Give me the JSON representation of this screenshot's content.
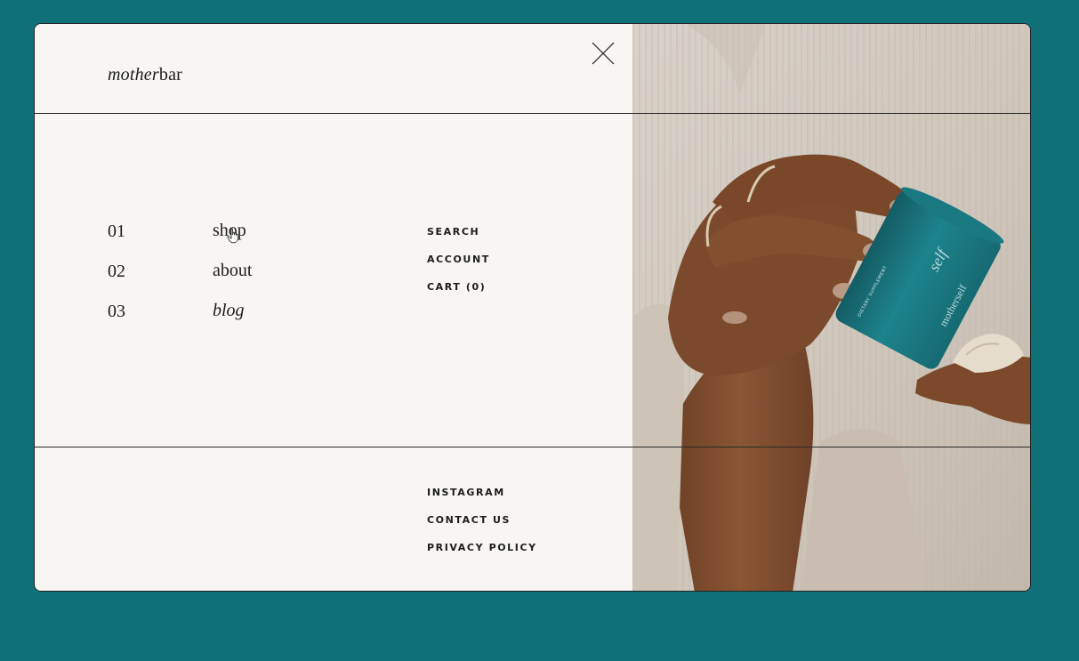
{
  "brand": {
    "logo_italic": "mother",
    "logo_regular": "bar"
  },
  "menu": {
    "primary": [
      {
        "number": "01",
        "label": "shop"
      },
      {
        "number": "02",
        "label": "about"
      },
      {
        "number": "03",
        "label": "blog"
      }
    ],
    "utility": [
      {
        "label": "SEARCH"
      },
      {
        "label": "ACCOUNT"
      },
      {
        "label": "CART (0)"
      }
    ],
    "footer": [
      {
        "label": "INSTAGRAM"
      },
      {
        "label": "CONTACT US"
      },
      {
        "label": "PRIVACY POLICY"
      }
    ]
  },
  "photo": {
    "can_label_main": "self",
    "can_label_side": "motherself",
    "can_label_small": "DIETARY SUPPLEMENT"
  },
  "colors": {
    "page_background": "#107078",
    "panel_background": "#f8f6f3",
    "text": "#1c1c1c",
    "can_teal": "#1d7f88"
  },
  "icons": {
    "close": "close-icon",
    "cursor": "hand-pointer-icon"
  }
}
